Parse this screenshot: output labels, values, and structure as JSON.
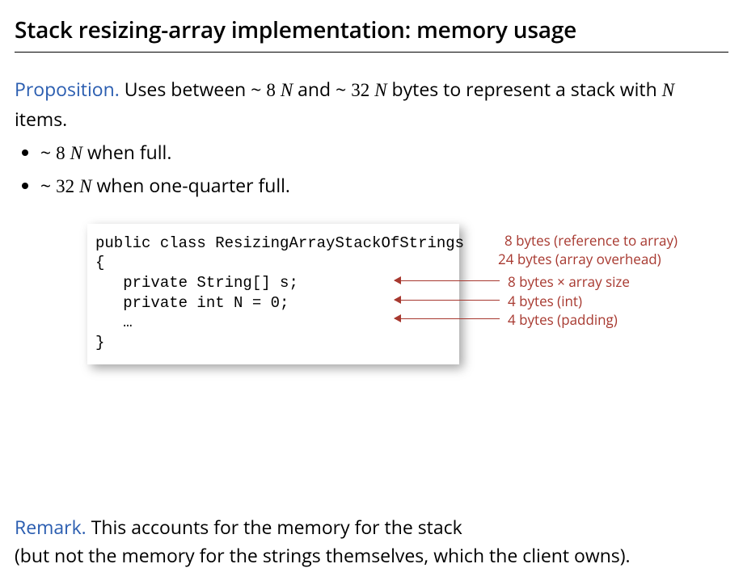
{
  "title": "Stack resizing-array implementation:  memory usage",
  "proposition": {
    "label": "Proposition.",
    "text_parts": {
      "p1": "  Uses between ~ ",
      "low_n": "8",
      "low_var": "N",
      "mid": " and ~ ",
      "high_n": "32",
      "high_var": "N",
      "p2": "  bytes to represent a stack with ",
      "nvar": "N",
      "p3": " items."
    }
  },
  "bullets": [
    {
      "tilde": "~ ",
      "coef": "8",
      "var": "N",
      "suffix": "  when full."
    },
    {
      "tilde": "~ ",
      "coef": "32",
      "var": "N",
      "suffix": " when one-quarter full."
    }
  ],
  "code": {
    "l0": "public class ResizingArrayStackOfStrings",
    "l1": "{",
    "l2": "   private String[] s;",
    "l3": "   private int N = 0;",
    "l4": "   …",
    "l5": "}"
  },
  "annotations": {
    "a0": "8 bytes (reference to array)",
    "a1": "24 bytes (array overhead)",
    "a2": "8 bytes × array size",
    "a3": "4 bytes (int)",
    "a4": "4 bytes (padding)"
  },
  "remark": {
    "label": "Remark.",
    "line1": "  This accounts for the memory for the stack",
    "line2": "(but not the memory for the strings themselves, which the client owns)."
  }
}
